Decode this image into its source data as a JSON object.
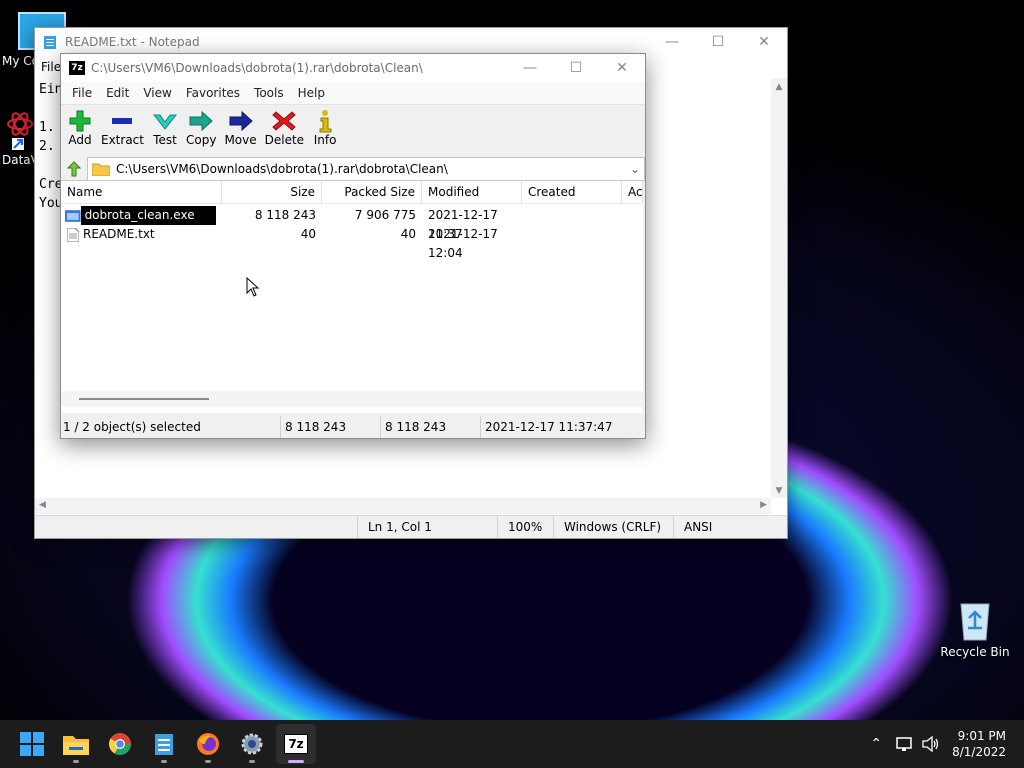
{
  "desktop": {
    "icons": [
      {
        "label": "My Co"
      },
      {
        "label": "DataV"
      },
      {
        "label": "Recycle Bin"
      }
    ]
  },
  "notepad": {
    "title": "README.txt - Notepad",
    "menu": [
      "File"
    ],
    "text_lines": [
      "Ein",
      "",
      "1.",
      "2.",
      "",
      "Cre",
      "You"
    ],
    "status": {
      "position": "Ln 1, Col 1",
      "zoom": "100%",
      "line_ending": "Windows (CRLF)",
      "encoding": "ANSI"
    }
  },
  "sevenzip": {
    "logo": "7z",
    "title": "C:\\Users\\VM6\\Downloads\\dobrota(1).rar\\dobrota\\Clean\\",
    "menu": [
      "File",
      "Edit",
      "View",
      "Favorites",
      "Tools",
      "Help"
    ],
    "toolbar": {
      "add": "Add",
      "extract": "Extract",
      "test": "Test",
      "copy": "Copy",
      "move": "Move",
      "delete": "Delete",
      "info": "Info"
    },
    "address": "C:\\Users\\VM6\\Downloads\\dobrota(1).rar\\dobrota\\Clean\\",
    "columns": {
      "name": "Name",
      "size": "Size",
      "packed": "Packed Size",
      "modified": "Modified",
      "created": "Created",
      "accessed": "Ac"
    },
    "rows": [
      {
        "name": "dobrota_clean.exe",
        "size": "8 118 243",
        "packed": "7 906 775",
        "modified": "2021-12-17 11:37",
        "selected": true
      },
      {
        "name": "README.txt",
        "size": "40",
        "packed": "40",
        "modified": "2021-12-17 12:04",
        "selected": false
      }
    ],
    "status": {
      "selection": "1 / 2 object(s) selected",
      "size": "8 118 243",
      "packed": "8 118 243",
      "modified": "2021-12-17 11:37:47"
    }
  },
  "taskbar": {
    "clock_time": "9:01 PM",
    "clock_date": "8/1/2022"
  }
}
